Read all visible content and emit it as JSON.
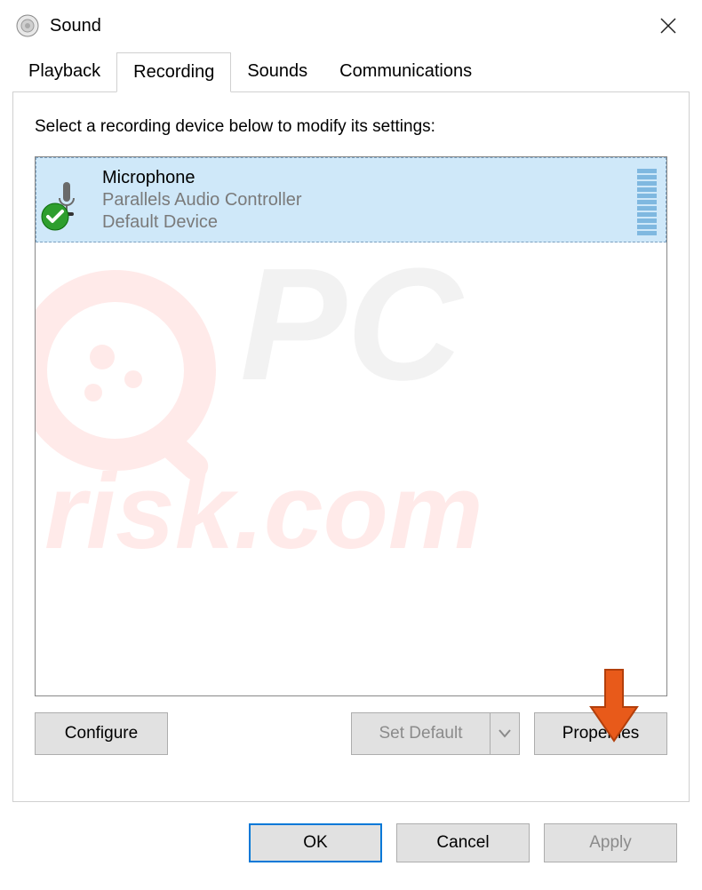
{
  "window": {
    "title": "Sound"
  },
  "tabs": {
    "playback": "Playback",
    "recording": "Recording",
    "sounds": "Sounds",
    "communications": "Communications",
    "active": "recording"
  },
  "panel": {
    "instruction": "Select a recording device below to modify its settings:"
  },
  "devices": [
    {
      "name": "Microphone",
      "driver": "Parallels Audio Controller",
      "status": "Default Device",
      "selected": true,
      "default": true
    }
  ],
  "panel_buttons": {
    "configure": "Configure",
    "set_default": "Set Default",
    "properties": "Properties"
  },
  "dialog_buttons": {
    "ok": "OK",
    "cancel": "Cancel",
    "apply": "Apply"
  },
  "watermark": "PCrisk.com"
}
